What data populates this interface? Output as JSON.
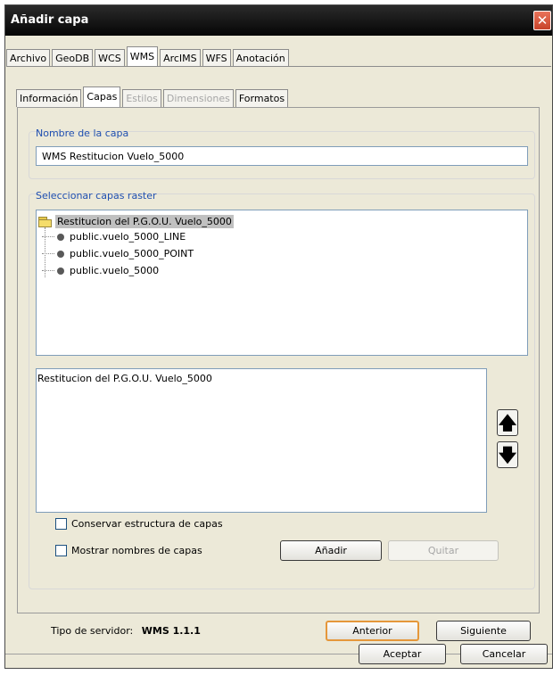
{
  "window": {
    "title": "Añadir capa",
    "close_symbol": "✕"
  },
  "top_tabs": [
    {
      "label": "Archivo",
      "state": "normal"
    },
    {
      "label": "GeoDB",
      "state": "normal"
    },
    {
      "label": "WCS",
      "state": "normal"
    },
    {
      "label": "WMS",
      "state": "active"
    },
    {
      "label": "ArcIMS",
      "state": "normal"
    },
    {
      "label": "WFS",
      "state": "normal"
    },
    {
      "label": "Anotación",
      "state": "normal"
    }
  ],
  "inner_tabs": [
    {
      "label": "Información",
      "state": "normal"
    },
    {
      "label": "Capas",
      "state": "active"
    },
    {
      "label": "Estilos",
      "state": "disabled"
    },
    {
      "label": "Dimensiones",
      "state": "disabled"
    },
    {
      "label": "Formatos",
      "state": "normal"
    }
  ],
  "layer_name": {
    "label": "Nombre de la capa",
    "value": "WMS Restitucion Vuelo_5000"
  },
  "raster": {
    "label": "Seleccionar capas raster",
    "root": "Restitucion del P.G.O.U. Vuelo_5000",
    "children": [
      "public.vuelo_5000_LINE",
      "public.vuelo_5000_POINT",
      "public.vuelo_5000"
    ],
    "icon_folder": "folder-icon",
    "icon_leaf": "layer-bullet-icon"
  },
  "selected_layers": [
    "Restitucion del P.G.O.U. Vuelo_5000"
  ],
  "move_up_symbol": "🡅",
  "move_down_symbol": "🡇",
  "options": {
    "keep_structure": "Conservar estructura de capas",
    "show_names": "Mostrar nombres de capas"
  },
  "buttons": {
    "add": "Añadir",
    "remove": "Quitar",
    "previous": "Anterior",
    "next": "Siguiente",
    "accept": "Aceptar",
    "cancel": "Cancelar"
  },
  "server": {
    "label": "Tipo de servidor:",
    "value": "WMS 1.1.1"
  },
  "colors": {
    "accent_label": "#1f4fb0",
    "titlebar": "#050505",
    "close": "#d65436",
    "focus_border": "#e5973a"
  }
}
